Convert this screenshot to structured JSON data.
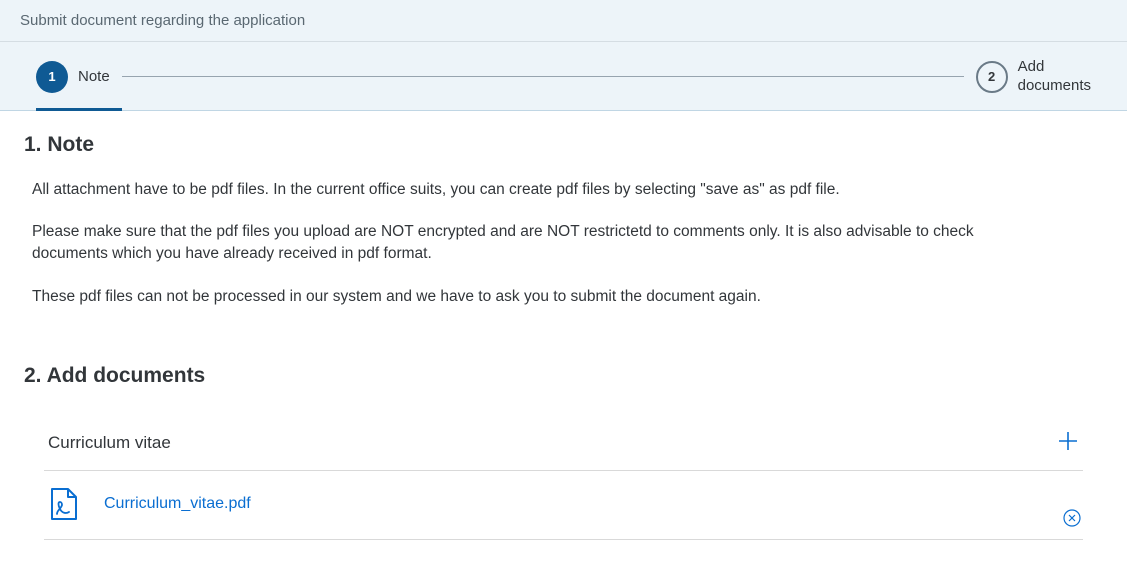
{
  "header": {
    "title": "Submit document regarding the application"
  },
  "wizard": {
    "step1": {
      "number": "1",
      "label": "Note"
    },
    "step2": {
      "number": "2",
      "label": "Add\ndocuments"
    }
  },
  "sections": {
    "note": {
      "title": "1. Note",
      "para1": "All attachment have to be pdf files. In the current office suits, you can create pdf files by selecting \"save as\" as pdf file.",
      "para2": "Please make sure that the pdf files you upload are NOT encrypted and are NOT restrictetd to comments only. It is also advisable to check documents which you have already received in pdf format.",
      "para3": "These pdf files can not be processed in our system and we have to ask you to submit the document again."
    },
    "add": {
      "title": "2. Add documents",
      "doc_type": "Curriculum vitae",
      "file_name": "Curriculum_vitae.pdf"
    }
  }
}
